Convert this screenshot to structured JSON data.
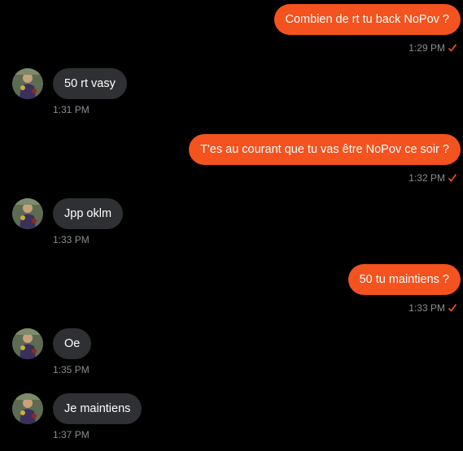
{
  "colors": {
    "outgoing_bubble": "#f4521e",
    "incoming_bubble": "#2f3033",
    "background": "#000000",
    "timestamp": "#8a8d91",
    "read_check": "#f4521e"
  },
  "messages": [
    {
      "direction": "outgoing",
      "text": "Combien de rt tu back NoPov ?",
      "time": "1:29 PM",
      "status_icon": "check-icon"
    },
    {
      "direction": "incoming",
      "text": "50 rt vasy",
      "time": "1:31 PM",
      "avatar_icon": "avatar-photo"
    },
    {
      "direction": "outgoing",
      "text": "T'es au courant que tu vas être NoPov ce soir ?",
      "time": "1:32 PM",
      "status_icon": "check-icon"
    },
    {
      "direction": "incoming",
      "text": "Jpp oklm",
      "time": "1:33 PM",
      "avatar_icon": "avatar-photo"
    },
    {
      "direction": "outgoing",
      "text": "50 tu maintiens ?",
      "time": "1:33 PM",
      "status_icon": "check-icon"
    },
    {
      "direction": "incoming",
      "text": "Oe",
      "time": "1:35 PM",
      "avatar_icon": "avatar-photo"
    },
    {
      "direction": "incoming",
      "text": "Je maintiens",
      "time": "1:37 PM",
      "avatar_icon": "avatar-photo"
    }
  ]
}
